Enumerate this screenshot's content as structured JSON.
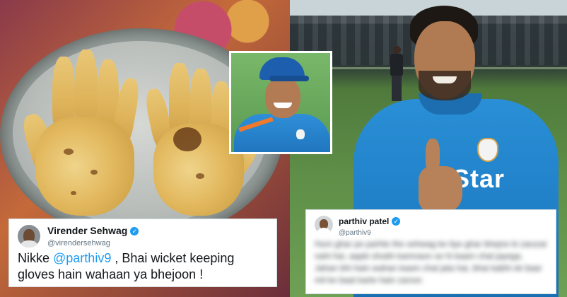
{
  "left_tweet": {
    "name": "Virender Sehwag",
    "handle": "@virendersehwag",
    "text_before": "Nikke ",
    "mention": "@parthiv9",
    "text_after": " , Bhai wicket keeping gloves hain wahaan ya bhejoon !"
  },
  "right_tweet": {
    "name": "parthiv patel",
    "handle": "@parthiv9",
    "blurred_text": "Hum ghar pe parhte the sehwag ke liye ghar bhejne ki zarurat nahi hai, aapki shubh kamnaon se hi kaam chal jayega. Jahan bhi hain wahan kaam chal jata hai, bhai kabhi ek baar mil ke baat karte hain zaroor."
  },
  "sponsor_text": "Star",
  "colors": {
    "mention": "#1d9bf0",
    "verified": "#1d9bf0",
    "jersey": "#2a8fd6"
  },
  "icons": {
    "verified": "verified-check-icon"
  }
}
